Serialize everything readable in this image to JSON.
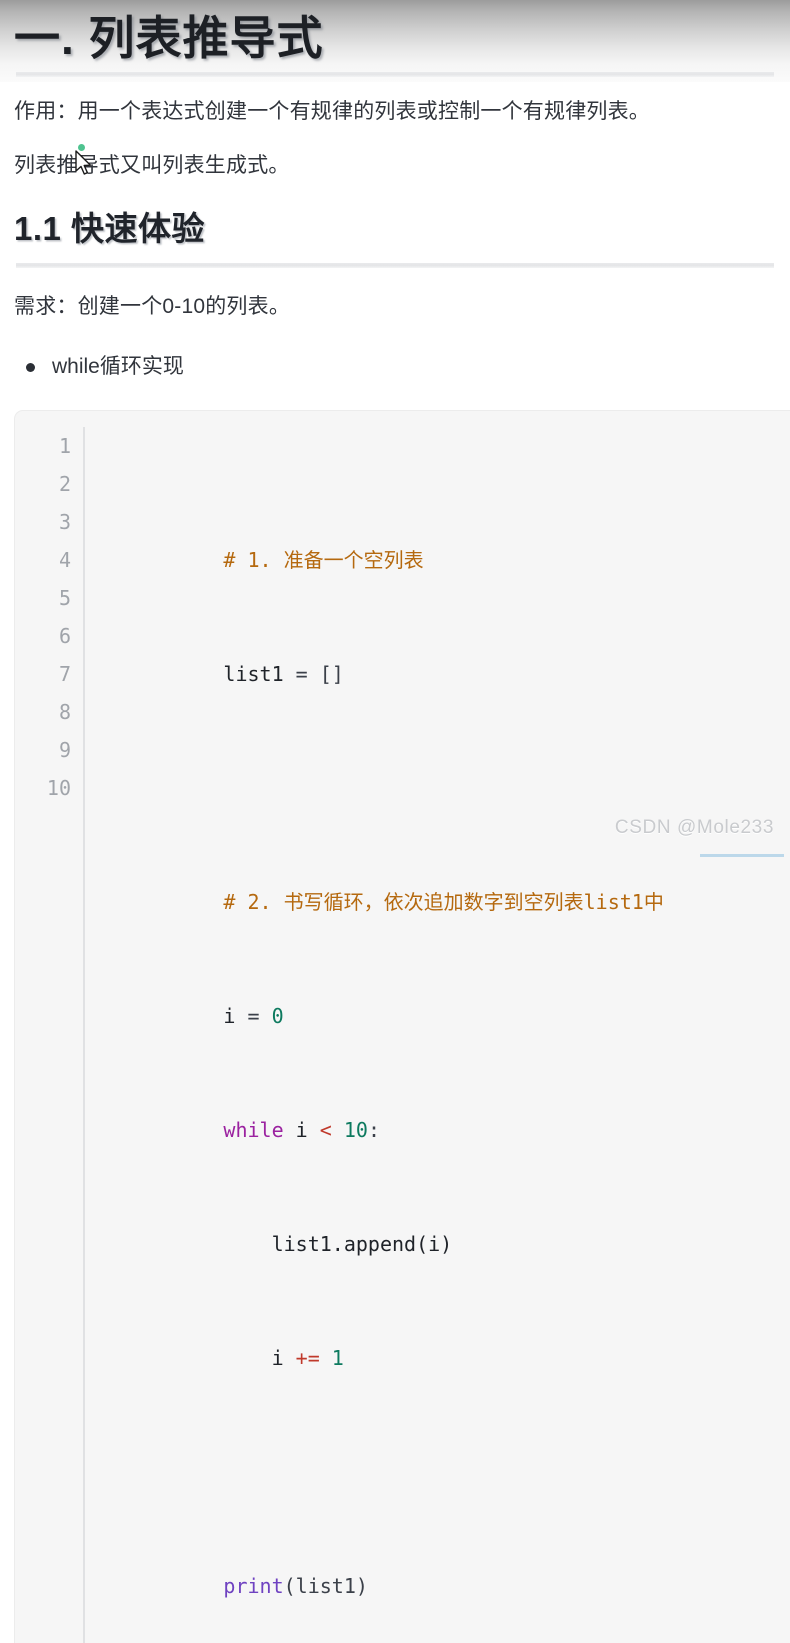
{
  "document": {
    "title": "一. 列表推导式",
    "paragraphs": [
      "作用：用一个表达式创建一个有规律的列表或控制一个有规律列表。",
      "列表推导式又叫列表生成式。"
    ],
    "section": {
      "heading": "1.1 快速体验",
      "requirement": "需求：创建一个0-10的列表。",
      "bullets": [
        "while循环实现"
      ]
    },
    "code_block": {
      "language": "python",
      "line_numbers": [
        "1",
        "2",
        "3",
        "4",
        "5",
        "6",
        "7",
        "8",
        "9",
        "10"
      ],
      "lines": [
        "# 1. 准备一个空列表",
        "list1 = []",
        "",
        "# 2. 书写循环，依次追加数字到空列表list1中",
        "i = 0",
        "while i < 10:",
        "    list1.append(i)",
        "    i += 1",
        "",
        "print(list1)"
      ],
      "tokens": {
        "l1_comment": "# 1. 准备一个空列表",
        "l2_name": "list1",
        "l2_rest": " = []",
        "l4_comment": "# 2. 书写循环，依次追加数字到空列表list1中",
        "l5_name": "i",
        "l5_eq": " = ",
        "l5_num": "0",
        "l6_kw": "while",
        "l6_var": " i ",
        "l6_op": "<",
        "l6_num": " 10",
        "l6_colon": ":",
        "l7_text": "    list1.append(i)",
        "l8_var": "    i ",
        "l8_op": "+=",
        "l8_num": " 1",
        "l10_fn": "print",
        "l10_rest": "(list1)"
      }
    }
  },
  "watermark": {
    "text": "CSDN @Mole233"
  },
  "colors": {
    "comment": "#b5690f",
    "keyword": "#9b22a0",
    "function": "#6f42c1",
    "number": "#0d7a5f",
    "operator": "#c0392b",
    "code_background": "#f6f6f6",
    "text": "#2c3038"
  }
}
